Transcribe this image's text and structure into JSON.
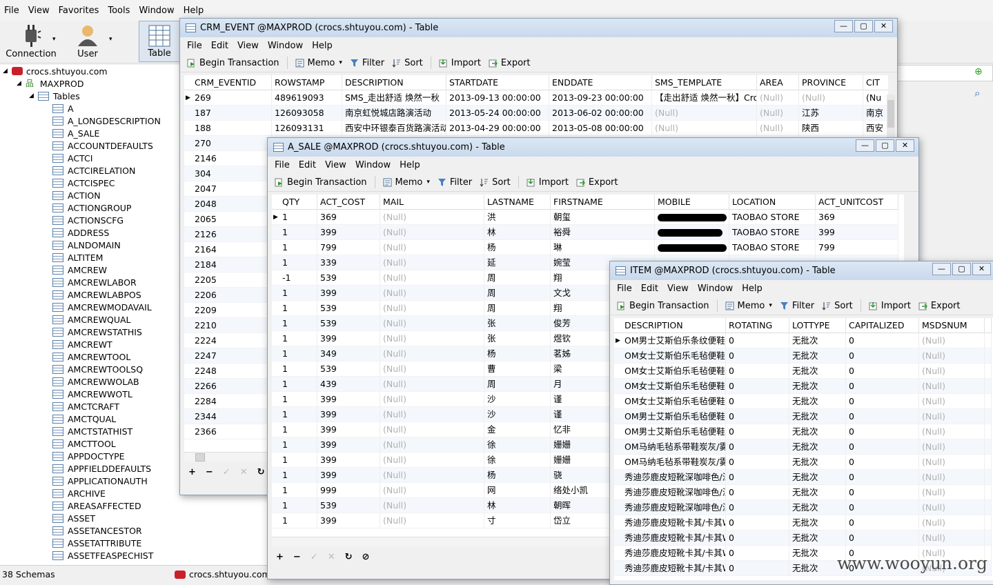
{
  "menubar": [
    "File",
    "View",
    "Favorites",
    "Tools",
    "Window",
    "Help"
  ],
  "toolbar": {
    "connection": "Connection",
    "user": "User",
    "table": "Table"
  },
  "tree": {
    "connection": "crocs.shtuyou.com",
    "schema": "MAXPROD",
    "tables_label": "Tables",
    "tables": [
      "A",
      "A_LONGDESCRIPTION",
      "A_SALE",
      "ACCOUNTDEFAULTS",
      "ACTCI",
      "ACTCIRELATION",
      "ACTCISPEC",
      "ACTION",
      "ACTIONGROUP",
      "ACTIONSCFG",
      "ADDRESS",
      "ALNDOMAIN",
      "ALTITEM",
      "AMCREW",
      "AMCREWLABOR",
      "AMCREWLABPOS",
      "AMCREWMODAVAIL",
      "AMCREWQUAL",
      "AMCREWSTATHIS",
      "AMCREWT",
      "AMCREWTOOL",
      "AMCREWTOOLSQ",
      "AMCREWWOLAB",
      "AMCREWWOTL",
      "AMCTCRAFT",
      "AMCTQUAL",
      "AMCTSTATHIST",
      "AMCTTOOL",
      "APPDOCTYPE",
      "APPFIELDDEFAULTS",
      "APPLICATIONAUTH",
      "ARCHIVE",
      "AREASAFFECTED",
      "ASSET",
      "ASSETANCESTOR",
      "ASSETATTRIBUTE",
      "ASSETFEASPECHIST"
    ]
  },
  "status": {
    "schemas": "38 Schemas",
    "connection": "crocs.shtuyou.com"
  },
  "win_menu": [
    "File",
    "Edit",
    "View",
    "Window",
    "Help"
  ],
  "win_tool": {
    "begin": "Begin Transaction",
    "memo": "Memo",
    "filter": "Filter",
    "sort": "Sort",
    "import": "Import",
    "export": "Export"
  },
  "crm": {
    "title": "CRM_EVENT @MAXPROD (crocs.shtuyou.com) - Table",
    "headers": [
      "CRM_EVENTID",
      "ROWSTAMP",
      "DESCRIPTION",
      "STARTDATE",
      "ENDDATE",
      "SMS_TEMPLATE",
      "AREA",
      "PROVINCE",
      "CIT"
    ],
    "rows": [
      [
        "269",
        "489619093",
        "SMS_走出舒适 焕然一秋",
        "2013-09-13 00:00:00",
        "2013-09-23 00:00:00",
        "【走出舒适 焕然一秋】Croc",
        "(Null)",
        "(Null)",
        "(Nu"
      ],
      [
        "187",
        "126093058",
        "南京虹悦城店路演活动",
        "2013-05-24 00:00:00",
        "2013-06-02 00:00:00",
        "(Null)",
        "(Null)",
        "江苏",
        "南京"
      ],
      [
        "188",
        "126093131",
        "西安中环银泰百货路演活动",
        "2013-04-29 00:00:00",
        "2013-05-08 00:00:00",
        "(Null)",
        "(Null)",
        "陕西",
        "西安"
      ],
      [
        "270"
      ],
      [
        "2146"
      ],
      [
        "304"
      ],
      [
        "2047"
      ],
      [
        "2048"
      ],
      [
        "2065"
      ],
      [
        "2126"
      ],
      [
        "2164"
      ],
      [
        "2184"
      ],
      [
        "2205"
      ],
      [
        "2206"
      ],
      [
        "2209"
      ],
      [
        "2210"
      ],
      [
        "2224"
      ],
      [
        "2247"
      ],
      [
        "2248"
      ],
      [
        "2266"
      ],
      [
        "2284"
      ],
      [
        "2344"
      ],
      [
        "2366"
      ]
    ]
  },
  "asale": {
    "title": "A_SALE @MAXPROD (crocs.shtuyou.com) - Table",
    "headers": [
      "QTY",
      "ACT_COST",
      "MAIL",
      "LASTNAME",
      "FIRSTNAME",
      "MOBILE",
      "LOCATION",
      "ACT_UNITCOST"
    ],
    "rows": [
      [
        "1",
        "369",
        "(Null)",
        "洪",
        "朝玺",
        "",
        "TAOBAO STORE",
        "369"
      ],
      [
        "1",
        "399",
        "(Null)",
        "林",
        "裕舜",
        "",
        "TAOBAO STORE",
        "399"
      ],
      [
        "1",
        "799",
        "(Null)",
        "杨",
        "琳",
        "",
        "TAOBAO STORE",
        "799"
      ],
      [
        "1",
        "339",
        "(Null)",
        "延",
        "婉莹"
      ],
      [
        "-1",
        "539",
        "(Null)",
        "周",
        "翔"
      ],
      [
        "1",
        "399",
        "(Null)",
        "周",
        "文戈"
      ],
      [
        "1",
        "539",
        "(Null)",
        "周",
        "翔"
      ],
      [
        "1",
        "539",
        "(Null)",
        "张",
        "俊芳"
      ],
      [
        "1",
        "399",
        "(Null)",
        "张",
        "煜钦"
      ],
      [
        "1",
        "349",
        "(Null)",
        "杨",
        "茗姊"
      ],
      [
        "1",
        "539",
        "(Null)",
        "曹",
        "梁"
      ],
      [
        "1",
        "439",
        "(Null)",
        "周",
        "月"
      ],
      [
        "1",
        "399",
        "(Null)",
        "沙",
        "谨"
      ],
      [
        "1",
        "399",
        "(Null)",
        "沙",
        "谨"
      ],
      [
        "1",
        "399",
        "(Null)",
        "金",
        "忆非"
      ],
      [
        "1",
        "399",
        "(Null)",
        "徐",
        "姗姗"
      ],
      [
        "1",
        "399",
        "(Null)",
        "徐",
        "姗姗"
      ],
      [
        "1",
        "399",
        "(Null)",
        "杨",
        "骁"
      ],
      [
        "1",
        "999",
        "(Null)",
        "网",
        "络处小凯"
      ],
      [
        "1",
        "539",
        "(Null)",
        "林",
        "朝晖"
      ],
      [
        "1",
        "399",
        "(Null)",
        "寸",
        "岱立"
      ]
    ]
  },
  "item": {
    "title": "ITEM @MAXPROD (crocs.shtuyou.com) - Table",
    "headers": [
      "DESCRIPTION",
      "ROTATING",
      "LOTTYPE",
      "CAPITALIZED",
      "MSDSNUM",
      ""
    ],
    "rows": [
      [
        "OM男士艾斯伯乐条纹便鞋",
        "0",
        "无批次",
        "0",
        "(Null)"
      ],
      [
        "OM女士艾斯伯乐毛毡便鞋",
        "0",
        "无批次",
        "0",
        "(Null)"
      ],
      [
        "OM女士艾斯伯乐毛毡便鞋",
        "0",
        "无批次",
        "0",
        "(Null)"
      ],
      [
        "OM女士艾斯伯乐毛毡便鞋",
        "0",
        "无批次",
        "0",
        "(Null)"
      ],
      [
        "OM女士艾斯伯乐毛毡便鞋",
        "0",
        "无批次",
        "0",
        "(Null)"
      ],
      [
        "OM男士艾斯伯乐毛毡便鞋",
        "0",
        "无批次",
        "0",
        "(Null)"
      ],
      [
        "OM男士艾斯伯乐毛毡便鞋",
        "0",
        "无批次",
        "0",
        "(Null)"
      ],
      [
        "OM马纳毛毡系带鞋炭灰/雾",
        "0",
        "无批次",
        "0",
        "(Null)"
      ],
      [
        "OM马纳毛毡系带鞋炭灰/雾",
        "0",
        "无批次",
        "0",
        "(Null)"
      ],
      [
        "秀迪莎鹿皮短靴深咖啡色/深",
        "0",
        "无批次",
        "0",
        "(Null)"
      ],
      [
        "秀迪莎鹿皮短靴深咖啡色/深",
        "0",
        "无批次",
        "0",
        "(Null)"
      ],
      [
        "秀迪莎鹿皮短靴深咖啡色/深",
        "0",
        "无批次",
        "0",
        "(Null)"
      ],
      [
        "秀迪莎鹿皮短靴卡其/卡其W",
        "0",
        "无批次",
        "0",
        "(Null)"
      ],
      [
        "秀迪莎鹿皮短靴卡其/卡其W",
        "0",
        "无批次",
        "0",
        "(Null)"
      ],
      [
        "秀迪莎鹿皮短靴卡其/卡其W",
        "0",
        "无批次",
        "0",
        "(Null)"
      ],
      [
        "秀迪莎鹿皮短靴卡其/卡其W",
        "0",
        "无批次",
        "0",
        "(Null)"
      ]
    ]
  },
  "watermark": "www.wooyun.org"
}
